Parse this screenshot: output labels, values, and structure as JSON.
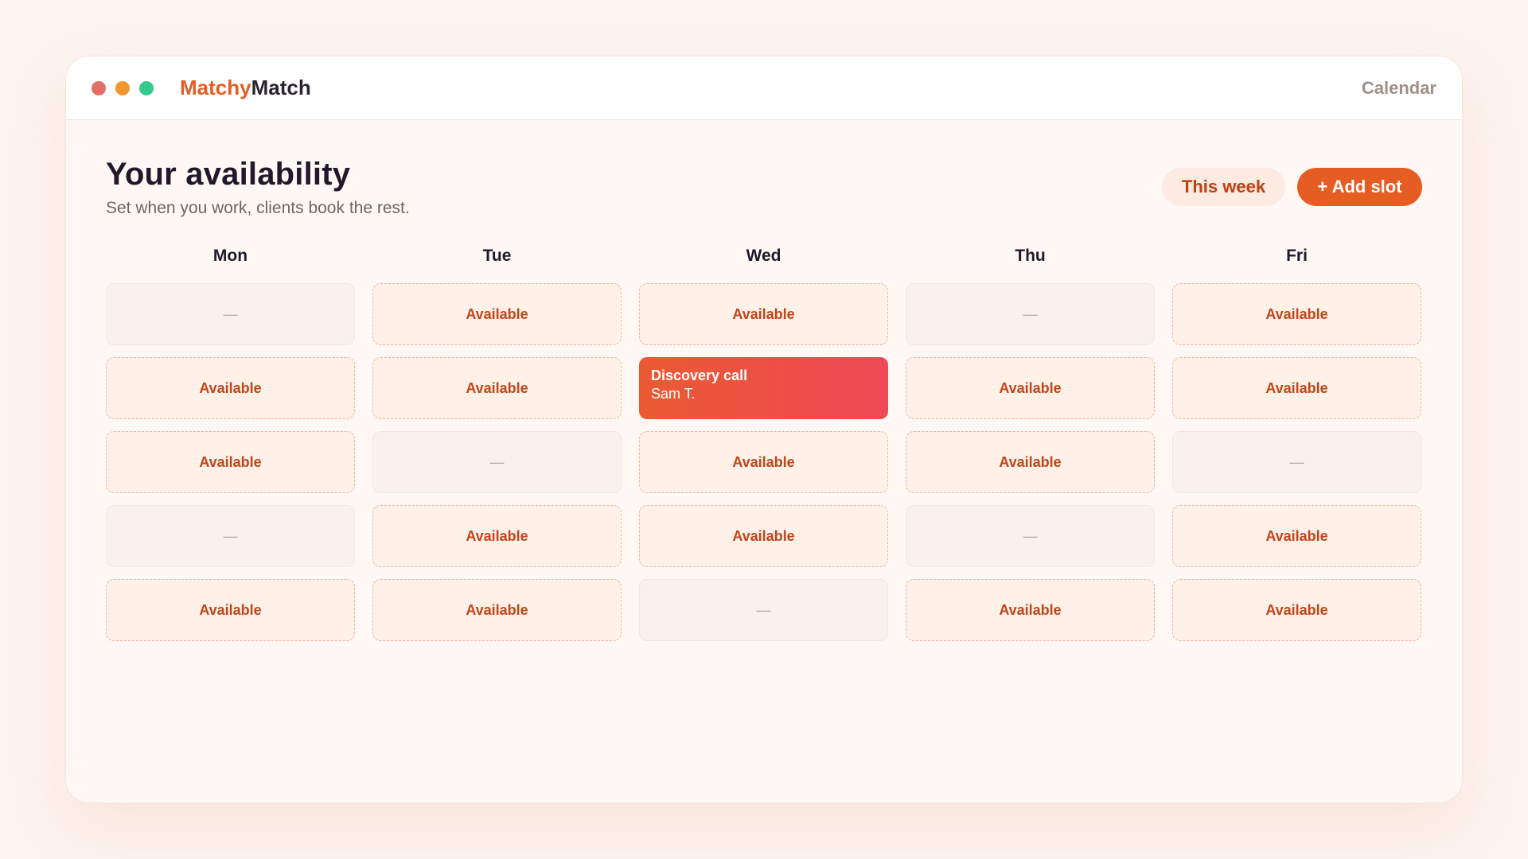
{
  "window": {
    "dots": [
      {
        "name": "close-dot",
        "color": "#e07068"
      },
      {
        "name": "minimize-dot",
        "color": "#f0962e"
      },
      {
        "name": "maximize-dot",
        "color": "#35c98c"
      }
    ]
  },
  "brand": {
    "accent": "Matchy",
    "rest": "Match"
  },
  "nav": {
    "calendar": "Calendar"
  },
  "header": {
    "title": "Your availability",
    "subtitle": "Set when you work, clients book the rest."
  },
  "actions": {
    "this_week": "This week",
    "add_slot": "+ Add slot"
  },
  "labels": {
    "available": "Available",
    "empty": "—"
  },
  "colors": {
    "accent": "#e65d24",
    "booked_start": "#ea5a32",
    "booked_end": "#ef4856"
  },
  "days": [
    {
      "label": "Mon",
      "slots": [
        {
          "state": "empty",
          "text": "—"
        },
        {
          "state": "available",
          "text": "Available"
        },
        {
          "state": "available",
          "text": "Available"
        },
        {
          "state": "empty",
          "text": "—"
        },
        {
          "state": "available",
          "text": "Available"
        }
      ]
    },
    {
      "label": "Tue",
      "slots": [
        {
          "state": "available",
          "text": "Available"
        },
        {
          "state": "available",
          "text": "Available"
        },
        {
          "state": "empty",
          "text": "—"
        },
        {
          "state": "available",
          "text": "Available"
        },
        {
          "state": "available",
          "text": "Available"
        }
      ]
    },
    {
      "label": "Wed",
      "slots": [
        {
          "state": "available",
          "text": "Available"
        },
        {
          "state": "booked",
          "title": "Discovery call",
          "client": "Sam T."
        },
        {
          "state": "available",
          "text": "Available"
        },
        {
          "state": "available",
          "text": "Available"
        },
        {
          "state": "empty",
          "text": "—"
        }
      ]
    },
    {
      "label": "Thu",
      "slots": [
        {
          "state": "empty",
          "text": "—"
        },
        {
          "state": "available",
          "text": "Available"
        },
        {
          "state": "available",
          "text": "Available"
        },
        {
          "state": "empty",
          "text": "—"
        },
        {
          "state": "available",
          "text": "Available"
        }
      ]
    },
    {
      "label": "Fri",
      "slots": [
        {
          "state": "available",
          "text": "Available"
        },
        {
          "state": "available",
          "text": "Available"
        },
        {
          "state": "empty",
          "text": "—"
        },
        {
          "state": "available",
          "text": "Available"
        },
        {
          "state": "available",
          "text": "Available"
        }
      ]
    }
  ]
}
